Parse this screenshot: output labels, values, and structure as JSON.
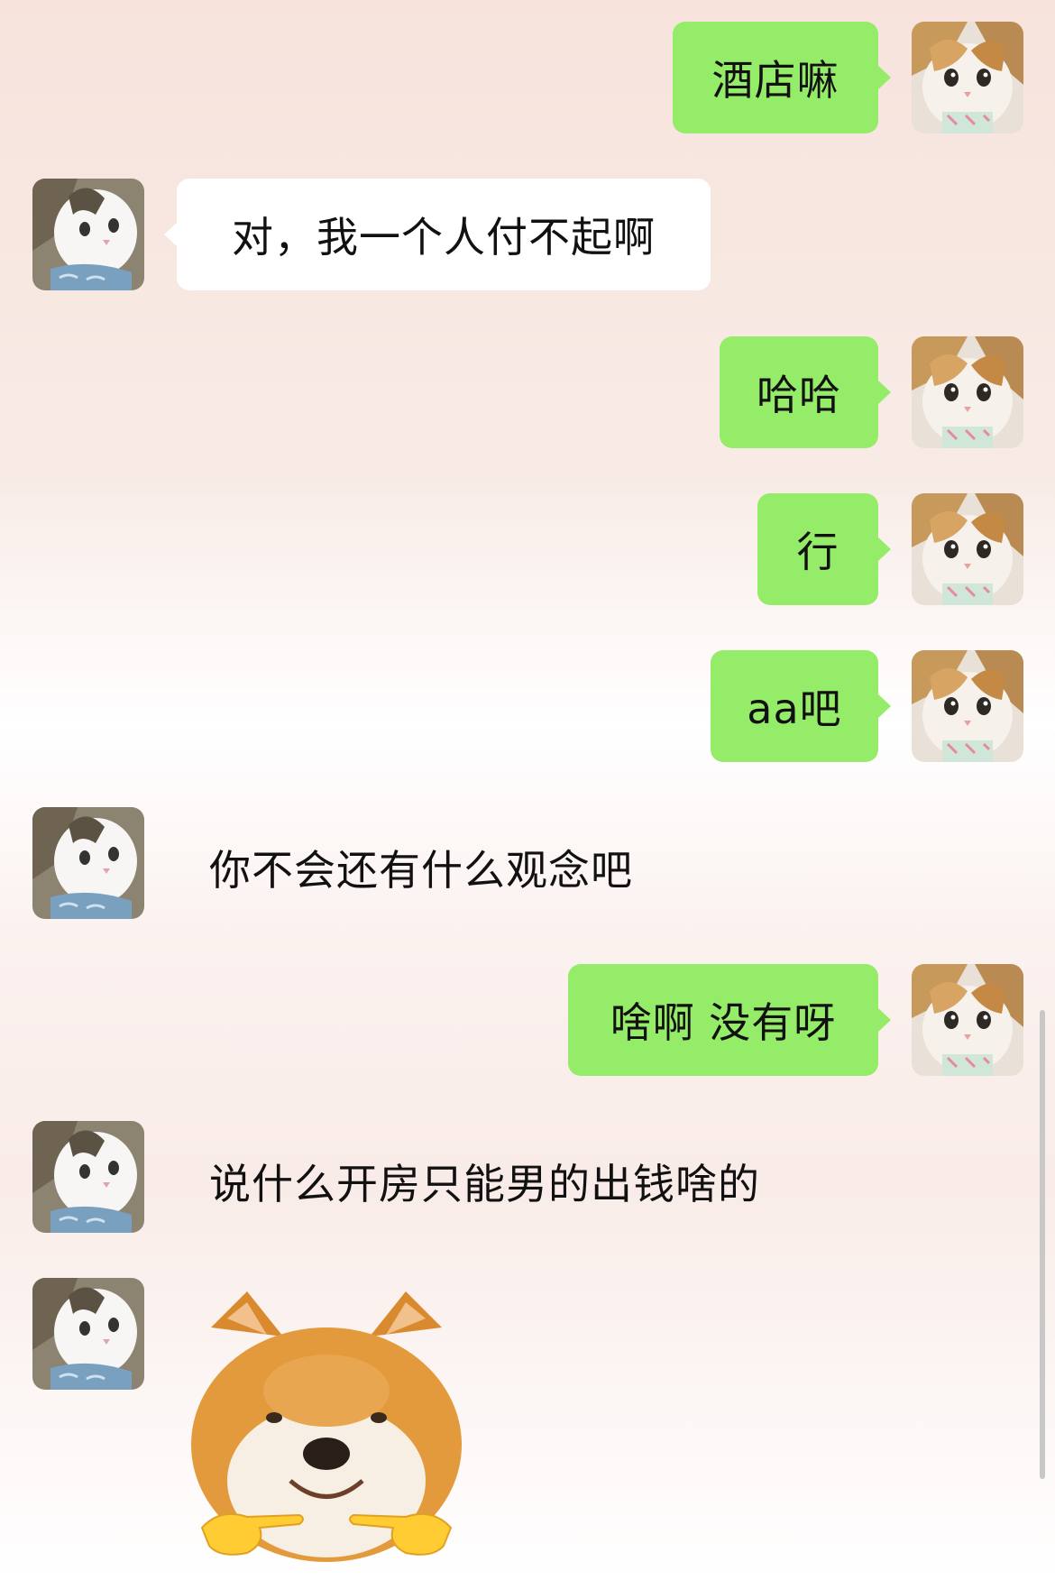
{
  "messages": [
    {
      "side": "right",
      "text": "酒店嘛"
    },
    {
      "side": "left",
      "text": "对，我一个人付不起啊"
    },
    {
      "side": "right",
      "text": "哈哈"
    },
    {
      "side": "right",
      "text": "行"
    },
    {
      "side": "right",
      "text": "aa吧"
    },
    {
      "side": "left",
      "text": "你不会还有什么观念吧"
    },
    {
      "side": "right",
      "text": "啥啊 没有呀"
    },
    {
      "side": "left",
      "text": "说什么开房只能男的出钱啥的"
    },
    {
      "side": "left",
      "sticker": "shiba-pointing-fingers-sticker"
    }
  ],
  "colors": {
    "outgoing_bubble": "#95ec69",
    "incoming_bubble": "#ffffff"
  },
  "avatars": {
    "self": "calico-cat-avatar",
    "other": "white-cat-avatar"
  }
}
